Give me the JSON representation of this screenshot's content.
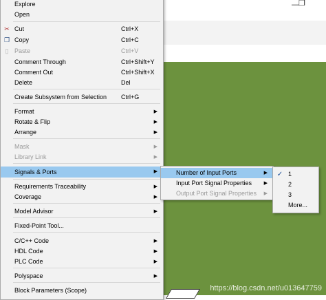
{
  "context_menu": {
    "items": [
      {
        "label": "Explore"
      },
      {
        "label": "Open"
      },
      {
        "label": "Cut",
        "shortcut": "Ctrl+X",
        "icon": "scissors-icon"
      },
      {
        "label": "Copy",
        "shortcut": "Ctrl+C",
        "icon": "copy-icon"
      },
      {
        "label": "Paste",
        "shortcut": "Ctrl+V",
        "icon": "paste-icon",
        "disabled": true
      },
      {
        "label": "Comment Through",
        "shortcut": "Ctrl+Shift+Y"
      },
      {
        "label": "Comment Out",
        "shortcut": "Ctrl+Shift+X"
      },
      {
        "label": "Delete",
        "shortcut": "Del"
      },
      {
        "label": "Create Subsystem from Selection",
        "shortcut": "Ctrl+G"
      },
      {
        "label": "Format"
      },
      {
        "label": "Rotate & Flip"
      },
      {
        "label": "Arrange"
      },
      {
        "label": "Mask",
        "disabled": true
      },
      {
        "label": "Library Link",
        "disabled": true
      },
      {
        "label": "Signals & Ports"
      },
      {
        "label": "Requirements Traceability"
      },
      {
        "label": "Coverage"
      },
      {
        "label": "Model Advisor"
      },
      {
        "label": "Fixed-Point Tool..."
      },
      {
        "label": "C/C++ Code"
      },
      {
        "label": "HDL Code"
      },
      {
        "label": "PLC Code"
      },
      {
        "label": "Polyspace"
      },
      {
        "label": "Block Parameters (Scope)"
      }
    ]
  },
  "signals_submenu": {
    "items": [
      {
        "label": "Number of Input Ports"
      },
      {
        "label": "Input Port Signal Properties"
      },
      {
        "label": "Output Port Signal Properties",
        "disabled": true
      }
    ]
  },
  "ports_submenu": {
    "items": [
      {
        "label": "1",
        "checked": true
      },
      {
        "label": "2"
      },
      {
        "label": "3"
      },
      {
        "label": "More..."
      }
    ]
  },
  "watermark": "https://blog.csdn.net/u013647759",
  "colors": {
    "canvas": "#6c923e",
    "highlight": "#99c9ef",
    "menu_bg": "#f2f2f2"
  }
}
